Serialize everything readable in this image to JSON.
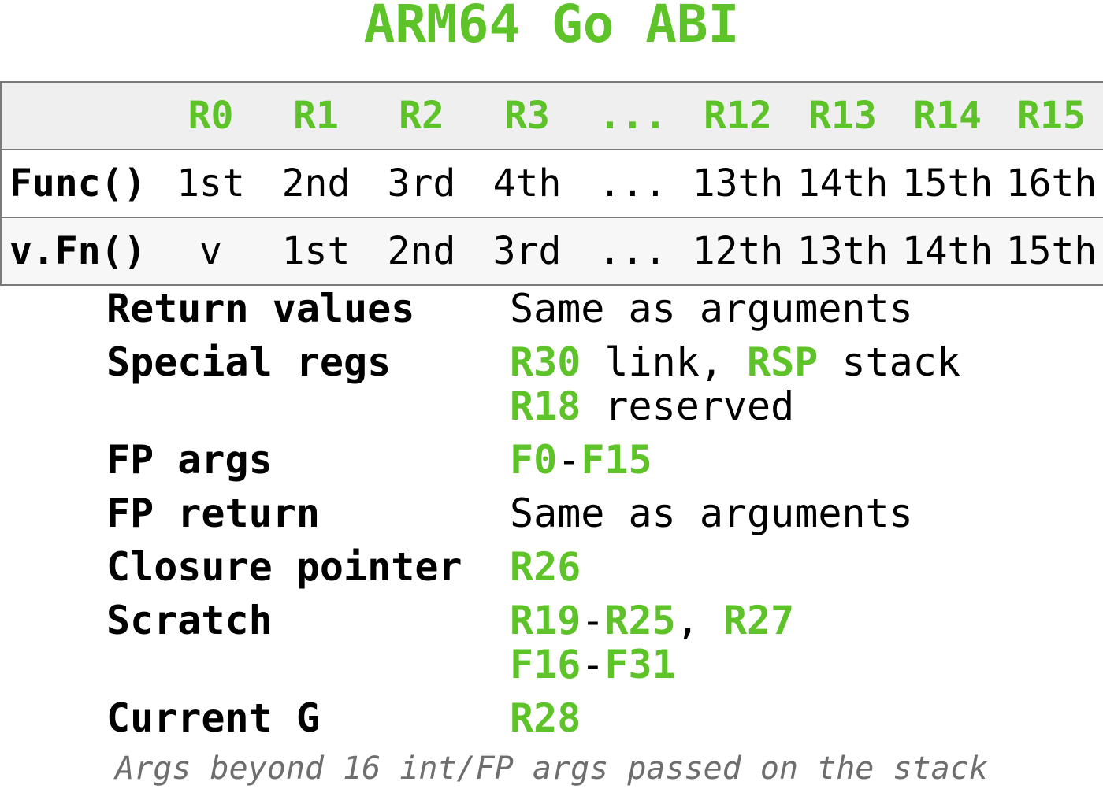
{
  "title": "ARM64 Go ABI",
  "colors": {
    "accent": "#5ec229",
    "text": "#000000",
    "header_bg": "#efefef",
    "border": "#7a7a7a",
    "footnote": "#6e6e6e"
  },
  "table": {
    "header": [
      "",
      "R0",
      "R1",
      "R2",
      "R3",
      "...",
      "R12",
      "R13",
      "R14",
      "R15"
    ],
    "rows": [
      [
        "Func()",
        "1st",
        "2nd",
        "3rd",
        "4th",
        "...",
        "13th",
        "14th",
        "15th",
        "16th"
      ],
      [
        "v.Fn()",
        "v",
        "1st",
        "2nd",
        "3rd",
        "...",
        "12th",
        "13th",
        "14th",
        "15th"
      ]
    ]
  },
  "notes": [
    {
      "label": "Return values",
      "lines": [
        [
          {
            "t": "Same as arguments"
          }
        ]
      ]
    },
    {
      "label": "Special regs",
      "lines": [
        [
          {
            "t": "R30",
            "r": true
          },
          {
            "t": " link, "
          },
          {
            "t": "RSP",
            "r": true
          },
          {
            "t": " stack"
          }
        ],
        [
          {
            "t": "R18",
            "r": true
          },
          {
            "t": " reserved"
          }
        ]
      ]
    },
    {
      "label": "FP args",
      "lines": [
        [
          {
            "t": "F0",
            "r": true
          },
          {
            "t": "-"
          },
          {
            "t": "F15",
            "r": true
          }
        ]
      ]
    },
    {
      "label": "FP return",
      "lines": [
        [
          {
            "t": "Same as arguments"
          }
        ]
      ]
    },
    {
      "label": "Closure pointer",
      "lines": [
        [
          {
            "t": "R26",
            "r": true
          }
        ]
      ]
    },
    {
      "label": "Scratch",
      "lines": [
        [
          {
            "t": "R19",
            "r": true
          },
          {
            "t": "-"
          },
          {
            "t": "R25",
            "r": true
          },
          {
            "t": ", "
          },
          {
            "t": "R27",
            "r": true
          }
        ],
        [
          {
            "t": "F16",
            "r": true
          },
          {
            "t": "-"
          },
          {
            "t": "F31",
            "r": true
          }
        ]
      ]
    },
    {
      "label": "Current G",
      "lines": [
        [
          {
            "t": "R28",
            "r": true
          }
        ]
      ]
    }
  ],
  "footnote": "Args beyond 16 int/FP args passed on the stack"
}
